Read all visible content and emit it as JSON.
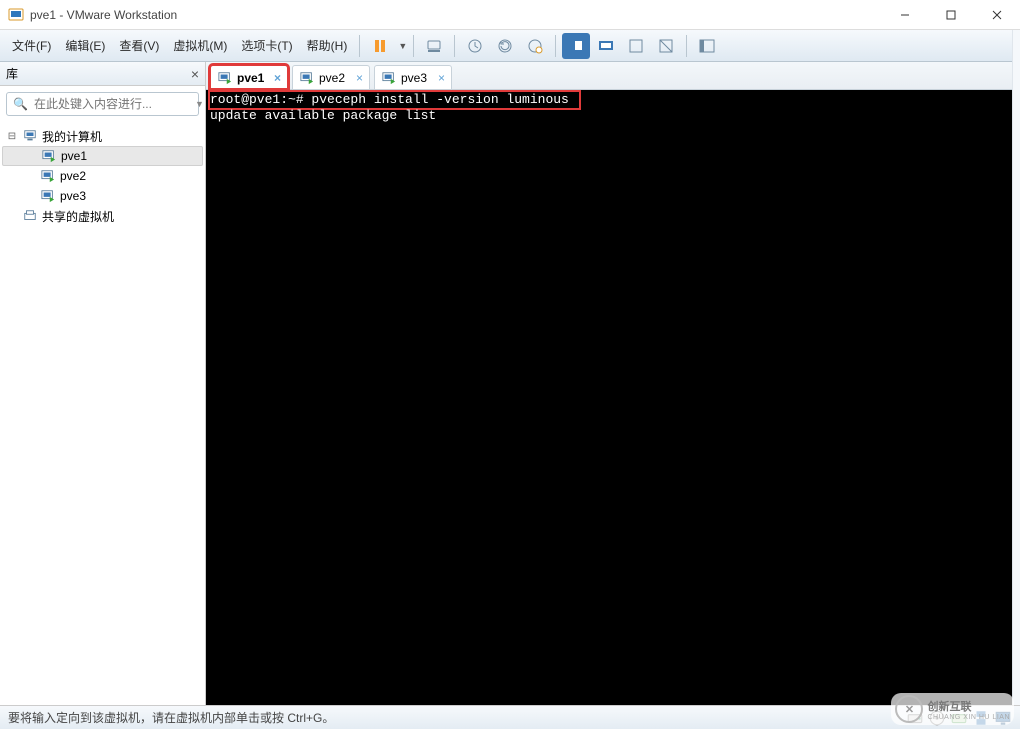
{
  "window": {
    "title": "pve1 - VMware Workstation"
  },
  "menu": {
    "file": "文件(F)",
    "edit": "编辑(E)",
    "view": "查看(V)",
    "vm": "虚拟机(M)",
    "tabs": "选项卡(T)",
    "help": "帮助(H)"
  },
  "library": {
    "title": "库",
    "search_placeholder": "在此处键入内容进行...",
    "nodes": {
      "my_computer": "我的计算机",
      "vm1": "pve1",
      "vm2": "pve2",
      "vm3": "pve3",
      "shared": "共享的虚拟机"
    }
  },
  "vmtabs": {
    "t1": "pve1",
    "t2": "pve2",
    "t3": "pve3"
  },
  "console": {
    "line1": "root@pve1:~# pveceph install -version luminous",
    "line2": "update available package list"
  },
  "statusbar": {
    "hint": "要将输入定向到该虚拟机，请在虚拟机内部单击或按 Ctrl+G。"
  },
  "watermark": {
    "text": "创新互联",
    "sub": "CHUANG XIN HU LIAN"
  }
}
